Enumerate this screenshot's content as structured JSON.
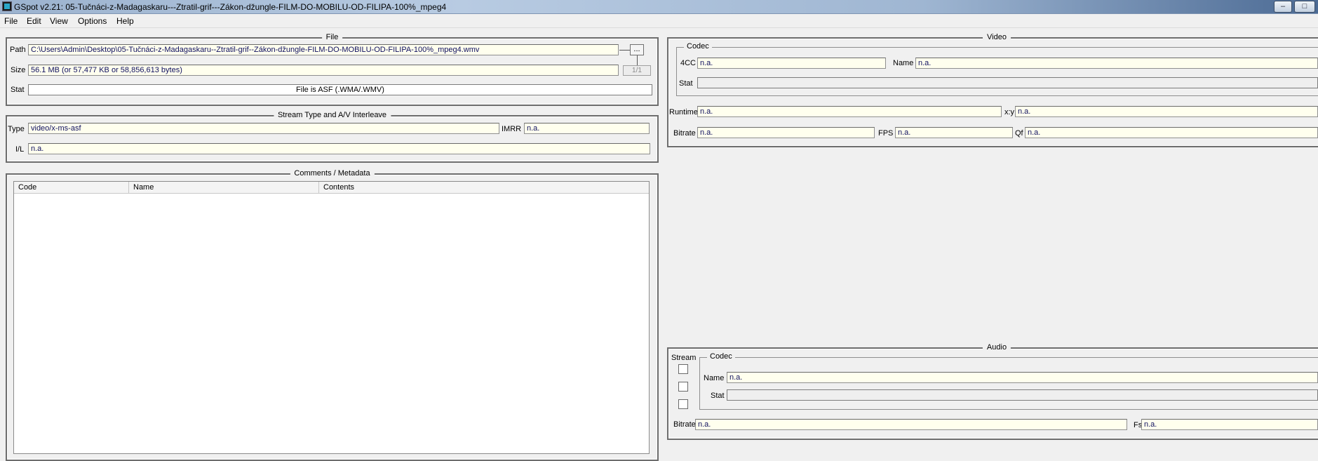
{
  "window": {
    "title": "GSpot v2.21: 05-Tučnáci-z-Madagaskaru---Ztratil-grif---Zákon-džungle-FILM-DO-MOBILU-OD-FILIPA-100%_mpeg4",
    "minimize": "–",
    "maximize": "□"
  },
  "menu": [
    "File",
    "Edit",
    "View",
    "Options",
    "Help"
  ],
  "file": {
    "legend": "File",
    "path_label": "Path",
    "path_value": "C:\\Users\\Admin\\Desktop\\05-Tučnáci-z-Madagaskaru--Ztratil-grif--Zákon-džungle-FILM-DO-MOBILU-OD-FILIPA-100%_mpeg4.wmv",
    "browse_label": "...",
    "size_label": "Size",
    "size_value": "56.1 MB (or 57,477 KB or 58,856,613 bytes)",
    "counter": "1/1",
    "stat_label": "Stat",
    "stat_value": "File is ASF (.WMA/.WMV)"
  },
  "stream": {
    "legend": "Stream Type and A/V Interleave",
    "type_label": "Type",
    "type_value": "video/x-ms-asf",
    "imrr_label": "IMRR",
    "imrr_value": "n.a.",
    "il_label": "I/L",
    "il_value": "n.a."
  },
  "comments": {
    "legend": "Comments / Metadata",
    "columns": [
      "Code",
      "Name",
      "Contents"
    ]
  },
  "video": {
    "legend": "Video",
    "codec_legend": "Codec",
    "fourcc_label": "4CC",
    "fourcc_value": "n.a.",
    "name_label": "Name",
    "name_value": "n.a.",
    "stat_label": "Stat",
    "stat_value": "",
    "runtime_label": "Runtime",
    "runtime_value": "n.a.",
    "xy_label": "x:y",
    "xy_value": "n.a.",
    "bitrate_label": "Bitrate",
    "bitrate_value": "n.a.",
    "fps_label": "FPS",
    "fps_value": "n.a.",
    "qf_label": "Qf",
    "qf_value": "n.a."
  },
  "audio": {
    "legend": "Audio",
    "stream_label": "Stream",
    "codec_legend": "Codec",
    "name_label": "Name",
    "name_value": "n.a.",
    "stat_label": "Stat",
    "stat_value": "",
    "bitrate_label": "Bitrate",
    "bitrate_value": "n.a.",
    "fs_label": "Fs",
    "fs_value": "n.a."
  }
}
